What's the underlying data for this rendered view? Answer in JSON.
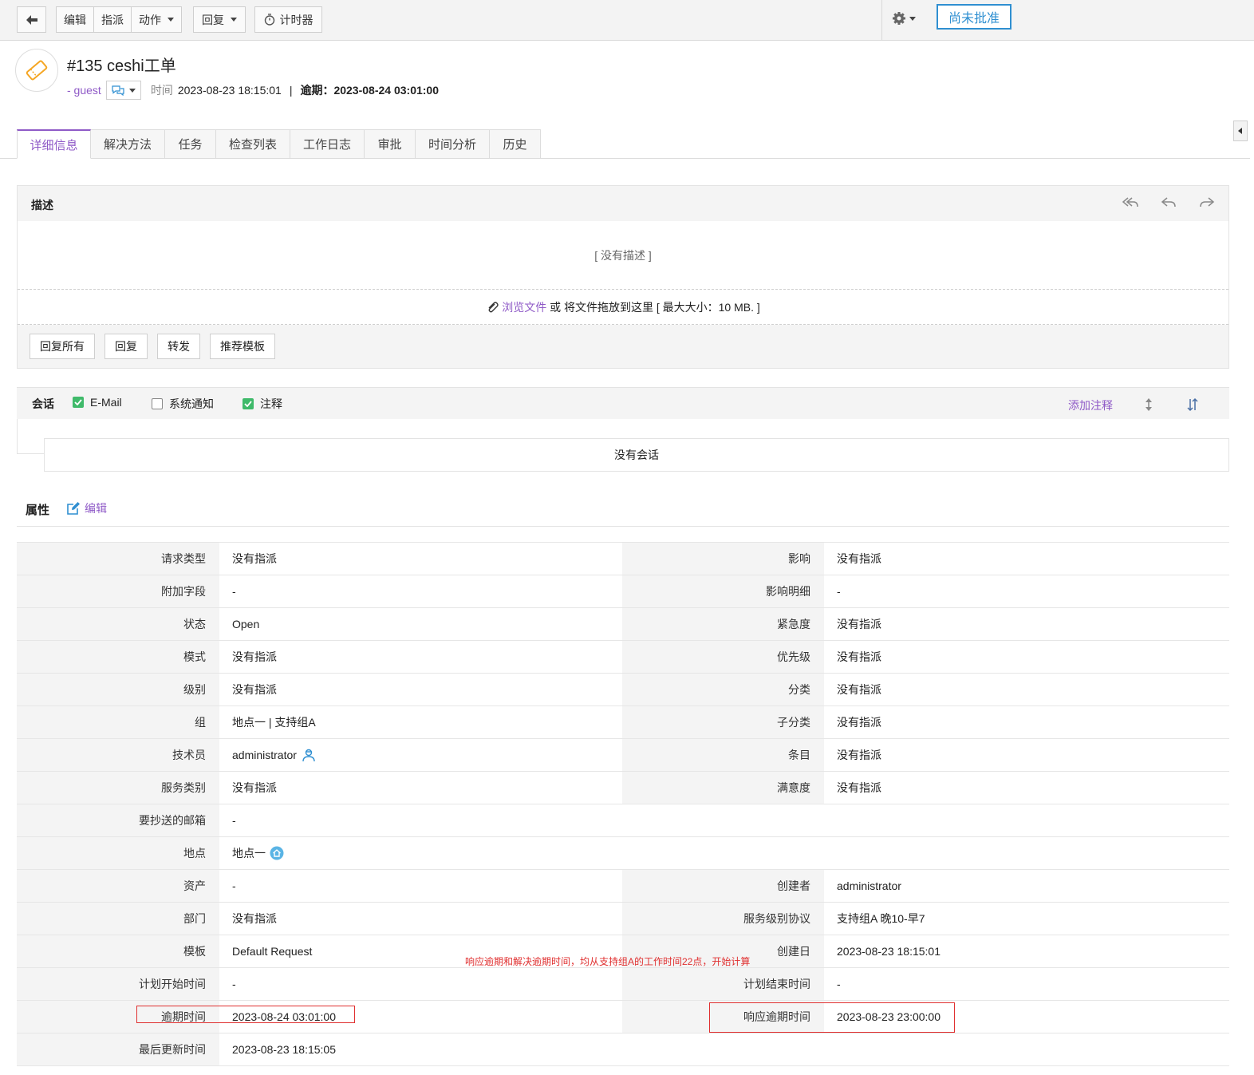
{
  "toolbar": {
    "edit": "编辑",
    "assign": "指派",
    "actions": "动作",
    "reply": "回复",
    "timer": "计时器",
    "status": "尚未批准"
  },
  "ticket": {
    "title": "#135  ceshi工单",
    "requester": "- guest",
    "time_label": "时间",
    "time_value": "2023-08-23 18:15:01",
    "sep": "|",
    "due_label": "逾期：",
    "due_value": "2023-08-24 03:01:00"
  },
  "tabs": [
    "详细信息",
    "解决方法",
    "任务",
    "检查列表",
    "工作日志",
    "审批",
    "时间分析",
    "历史"
  ],
  "description": {
    "heading": "描述",
    "empty": "[ 没有描述 ]",
    "browse": "浏览文件",
    "drop_text": " 或 将文件拖放到这里 [ 最大大小：10 MB. ]",
    "buttons": [
      "回复所有",
      "回复",
      "转发",
      "推荐模板"
    ]
  },
  "conversation": {
    "label": "会话",
    "email": "E-Mail",
    "system": "系统通知",
    "note": "注释",
    "add_note": "添加注释",
    "empty": "没有会话"
  },
  "properties": {
    "title": "属性",
    "edit": "编辑",
    "rows": [
      {
        "l1": "请求类型",
        "v1": "没有指派",
        "l2": "影响",
        "v2": "没有指派"
      },
      {
        "l1": "附加字段",
        "v1": "-",
        "l2": "影响明细",
        "v2": "-"
      },
      {
        "l1": "状态",
        "v1": "Open",
        "l2": "紧急度",
        "v2": "没有指派"
      },
      {
        "l1": "模式",
        "v1": "没有指派",
        "l2": "优先级",
        "v2": "没有指派"
      },
      {
        "l1": "级别",
        "v1": "没有指派",
        "l2": "分类",
        "v2": "没有指派"
      },
      {
        "l1": "组",
        "v1": "地点一 | 支持组A",
        "l2": "子分类",
        "v2": "没有指派"
      },
      {
        "l1": "技术员",
        "v1": "administrator",
        "l2": "条目",
        "v2": "没有指派"
      },
      {
        "l1": "服务类别",
        "v1": "没有指派",
        "l2": "满意度",
        "v2": "没有指派"
      },
      {
        "l1": "要抄送的邮箱",
        "v1": "-"
      },
      {
        "l1": "地点",
        "v1": "地点一"
      },
      {
        "l1": "资产",
        "v1": "-",
        "l2": "创建者",
        "v2": "administrator"
      },
      {
        "l1": "部门",
        "v1": "没有指派",
        "l2": "服务级别协议",
        "v2": "支持组A 晚10-早7"
      },
      {
        "l1": "模板",
        "v1": "Default Request",
        "l2": "创建日",
        "v2": "2023-08-23 18:15:01"
      },
      {
        "l1": "计划开始时间",
        "v1": "-",
        "l2": "计划结束时间",
        "v2": "-"
      },
      {
        "l1": "逾期时间",
        "v1": "2023-08-24 03:01:00",
        "l2": "响应逾期时间",
        "v2": "2023-08-23 23:00:00"
      },
      {
        "l1": "最后更新时间",
        "v1": "2023-08-23 18:15:05"
      }
    ]
  },
  "annotation": "响应逾期和解决逾期时间，均从支持组A的工作时间22点，开始计算"
}
